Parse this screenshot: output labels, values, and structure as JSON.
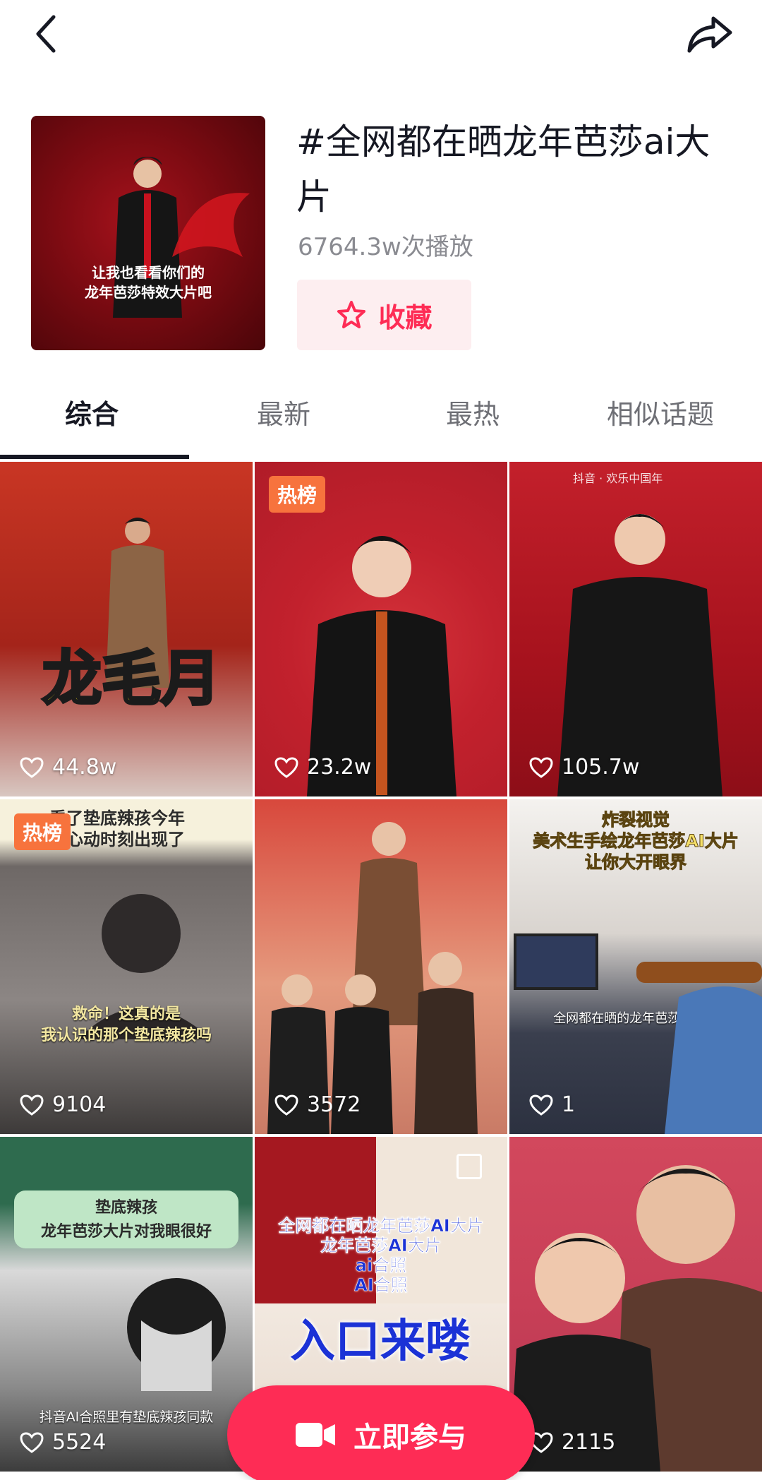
{
  "topic": {
    "title": "#全网都在晒龙年芭莎ai大片",
    "play_count": "6764.3w次播放",
    "favorite_label": "收藏",
    "cover_caption_line1": "让我也看看你们的",
    "cover_caption_line2": "龙年芭莎特效大片吧"
  },
  "tabs": [
    {
      "label": "综合"
    },
    {
      "label": "最新"
    },
    {
      "label": "最热"
    },
    {
      "label": "相似话题"
    }
  ],
  "videos": [
    {
      "likes": "44.8w",
      "overlay_text": "龙毛月"
    },
    {
      "likes": "23.2w",
      "badge": "热榜"
    },
    {
      "likes": "105.7w",
      "watermark": "抖音 · 欢乐中国年"
    },
    {
      "likes": "9104",
      "badge": "热榜",
      "top_text": "看了垫底辣孩今年",
      "top_text2": "个心动时刻出现了",
      "sub_text": "救命！这真的是",
      "sub_text2": "我认识的那个垫底辣孩吗"
    },
    {
      "likes": "3572"
    },
    {
      "likes": "1",
      "top_text": "炸裂视觉",
      "top_text2": "美术生手绘龙年芭莎AI大片",
      "top_text3": "让你大开眼界",
      "sub_text": "全网都在晒的龙年芭莎AI大片"
    },
    {
      "likes": "5524",
      "top_text": "垫底辣孩",
      "top_text2": "龙年芭莎大片对我眼很好",
      "sub_text": "抖音AI合照里有垫底辣孩同款"
    },
    {
      "likes": "",
      "top_text": "全网都在晒龙年芭莎AI大片",
      "top_text2": "龙年芭莎AI大片",
      "top_text3": "ai合照",
      "top_text4": "AI合照",
      "big_text": "入口来喽"
    },
    {
      "likes": "2115"
    }
  ],
  "join_button": {
    "label": "立即参与"
  },
  "colors": {
    "accent": "#fe2c55",
    "badge": "#f7733d",
    "fav_bg": "#fdeef0"
  }
}
